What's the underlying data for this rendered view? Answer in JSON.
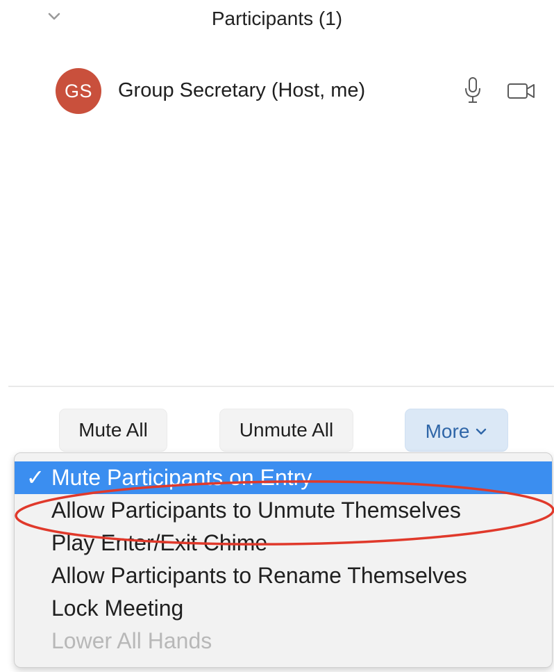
{
  "header": {
    "title": "Participants (1)"
  },
  "participants": [
    {
      "initials": "GS",
      "name": "Group Secretary (Host, me)",
      "avatar_color": "#c9503c"
    }
  ],
  "toolbar": {
    "mute_all_label": "Mute All",
    "unmute_all_label": "Unmute All",
    "more_label": "More"
  },
  "more_menu": {
    "items": [
      {
        "label": "Mute Participants on Entry",
        "checked": true,
        "enabled": true
      },
      {
        "label": "Allow Participants to Unmute Themselves",
        "checked": false,
        "enabled": true
      },
      {
        "label": "Play Enter/Exit Chime",
        "checked": false,
        "enabled": true
      },
      {
        "label": "Allow Participants to Rename Themselves",
        "checked": false,
        "enabled": true
      },
      {
        "label": "Lock Meeting",
        "checked": false,
        "enabled": true
      },
      {
        "label": "Lower All Hands",
        "checked": false,
        "enabled": false
      }
    ],
    "check_glyph": "✓"
  },
  "colors": {
    "highlight": "#3b8ef0",
    "more_button_bg": "#dbe8f6",
    "more_button_text": "#2f66a8",
    "annotation": "#e0392b",
    "disabled_text": "#b8b8b8"
  },
  "icons": {
    "collapse": "chevron-down-icon",
    "mic": "microphone-icon",
    "video": "video-camera-icon",
    "more_dropdown": "chevron-down-icon"
  }
}
